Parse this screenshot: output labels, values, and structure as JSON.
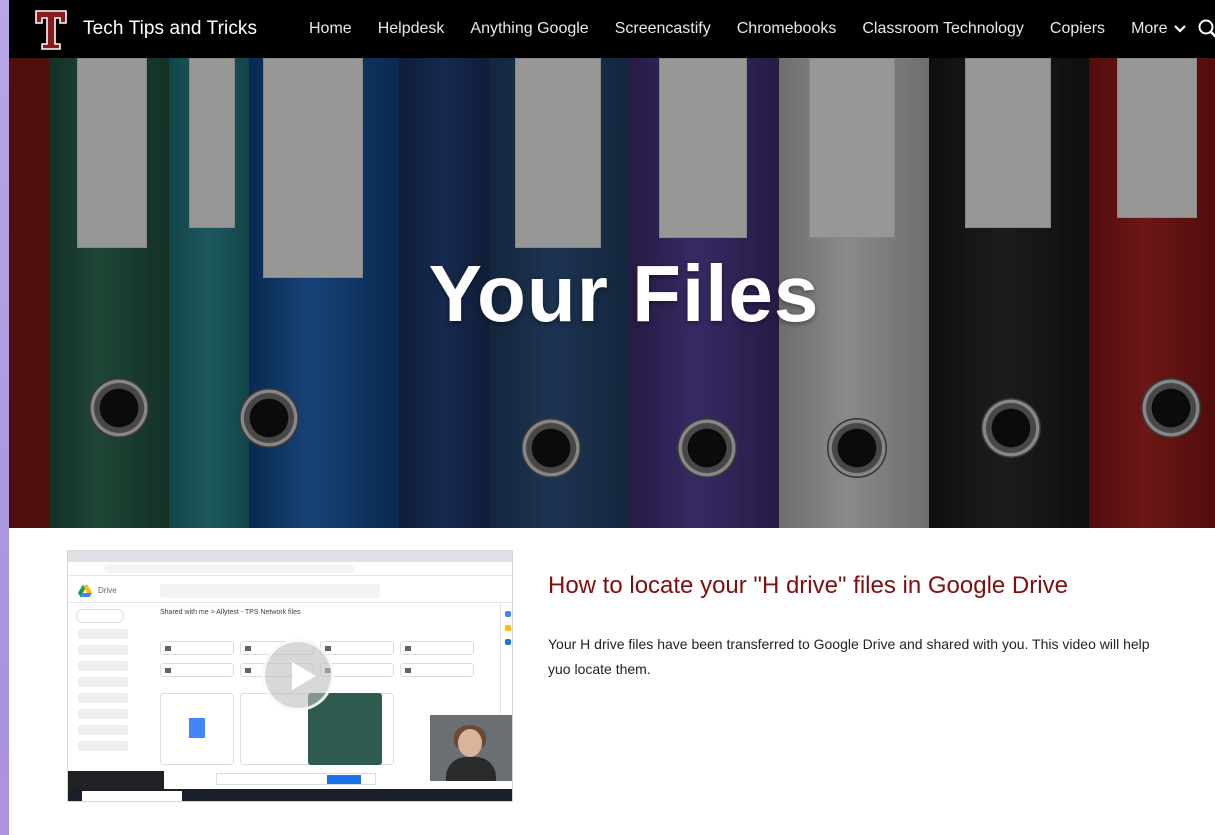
{
  "site": {
    "title": "Tech Tips and Tricks",
    "logo_letter": "T",
    "brand_color": "#8b1a1a"
  },
  "nav": {
    "items": [
      "Home",
      "Helpdesk",
      "Anything Google",
      "Screencastify",
      "Chromebooks",
      "Classroom Technology",
      "Copiers"
    ],
    "more_label": "More",
    "icons": {
      "more": "chevron-down-icon",
      "search": "search-icon"
    }
  },
  "hero": {
    "title": "Your Files"
  },
  "video": {
    "icon": "play-icon",
    "screenshot_breadcrumb": "Shared with me  >  Allytest - TPS Network files",
    "drive_label": "Drive"
  },
  "article": {
    "title": "How to locate your \"H drive\" files in Google Drive",
    "body": "Your H drive files have been transferred to Google Drive and shared with you. This video will help yuo locate them.",
    "title_color": "#7f0f0f"
  }
}
